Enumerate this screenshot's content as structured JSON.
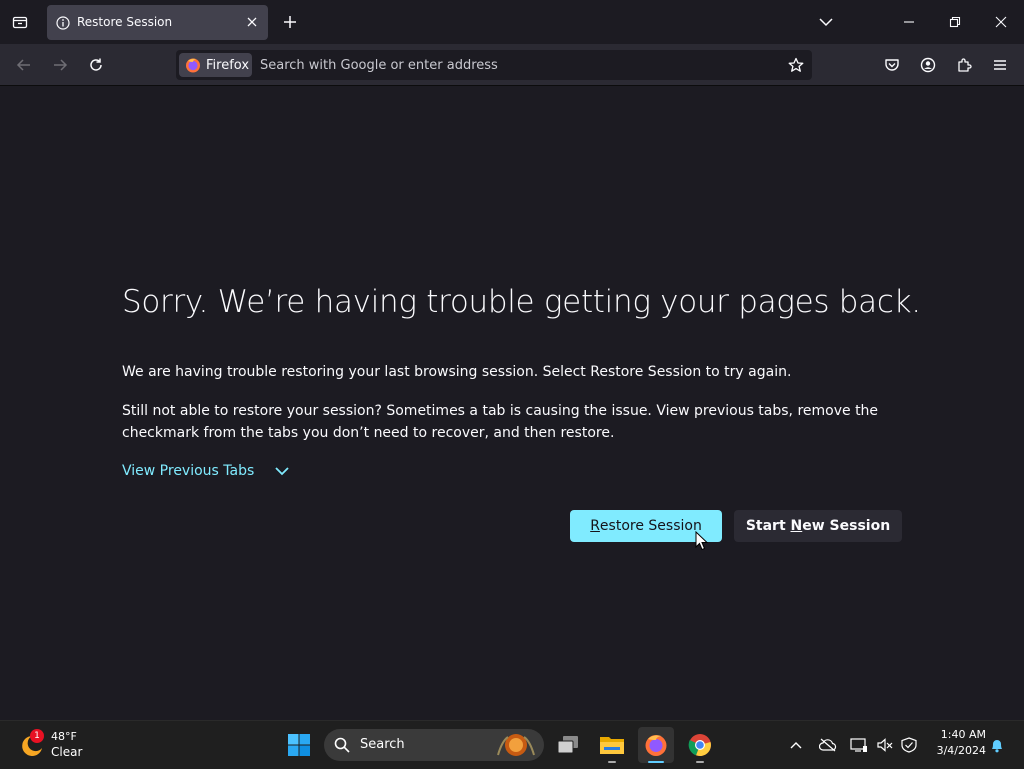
{
  "tab": {
    "title": "Restore Session"
  },
  "urlbar": {
    "identity_label": "Firefox",
    "placeholder": "Search with Google or enter address"
  },
  "page": {
    "heading": "Sorry. We’re having trouble getting your pages back.",
    "para1": "We are having trouble restoring your last browsing session. Select Restore Session to try again.",
    "para2": "Still not able to restore your session? Sometimes a tab is causing the issue. View previous tabs, remove the checkmark from the tabs you don’t need to recover, and then restore.",
    "view_previous_tabs": "View Previous Tabs",
    "restore_button": {
      "pre": "",
      "accel": "R",
      "post": "estore Session"
    },
    "new_session_button": {
      "pre": "Start ",
      "accel": "N",
      "post": "ew Session"
    }
  },
  "taskbar": {
    "weather": {
      "badge": "1",
      "temp": "48°F",
      "condition": "Clear"
    },
    "search_label": "Search",
    "time": "1:40 AM",
    "date": "3/4/2024"
  },
  "colors": {
    "accent": "#80ebff",
    "page_bg": "#1c1b22",
    "toolbar_bg": "#2b2a33",
    "taskbar_bg": "#1f1f1f"
  }
}
